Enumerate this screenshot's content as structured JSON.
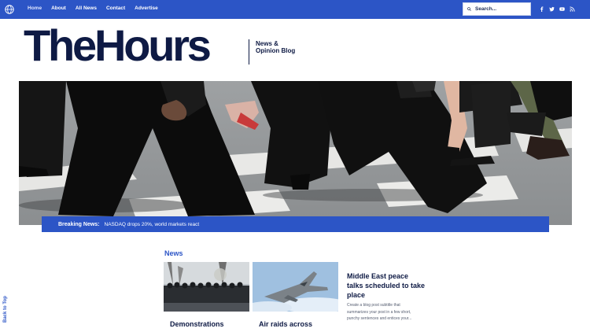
{
  "nav": {
    "items": [
      {
        "label": "Home",
        "active": true
      },
      {
        "label": "About"
      },
      {
        "label": "All News"
      },
      {
        "label": "Contact"
      },
      {
        "label": "Advertise"
      }
    ],
    "search_placeholder": "Search...",
    "social_icons": [
      "facebook-icon",
      "twitter-icon",
      "youtube-icon",
      "rss-icon"
    ]
  },
  "brand": {
    "logo": "TheHours",
    "tagline": "News & Opinion Blog"
  },
  "breaking": {
    "label": "Breaking News:",
    "text": "NASDAQ drops 20%, world markets react"
  },
  "news": {
    "section_title": "News",
    "cards": [
      {
        "title": "Demonstrations"
      },
      {
        "title": "Air raids across"
      }
    ],
    "featured": {
      "title": "Middle East peace talks scheduled to take place",
      "subtitle": "Create a blog post subtitle that summarizes your post in a few short, punchy sentences and entices your..."
    }
  },
  "back_to_top": "Back to Top",
  "colors": {
    "accent": "#2c55c6",
    "brand": "#0e1a44"
  }
}
